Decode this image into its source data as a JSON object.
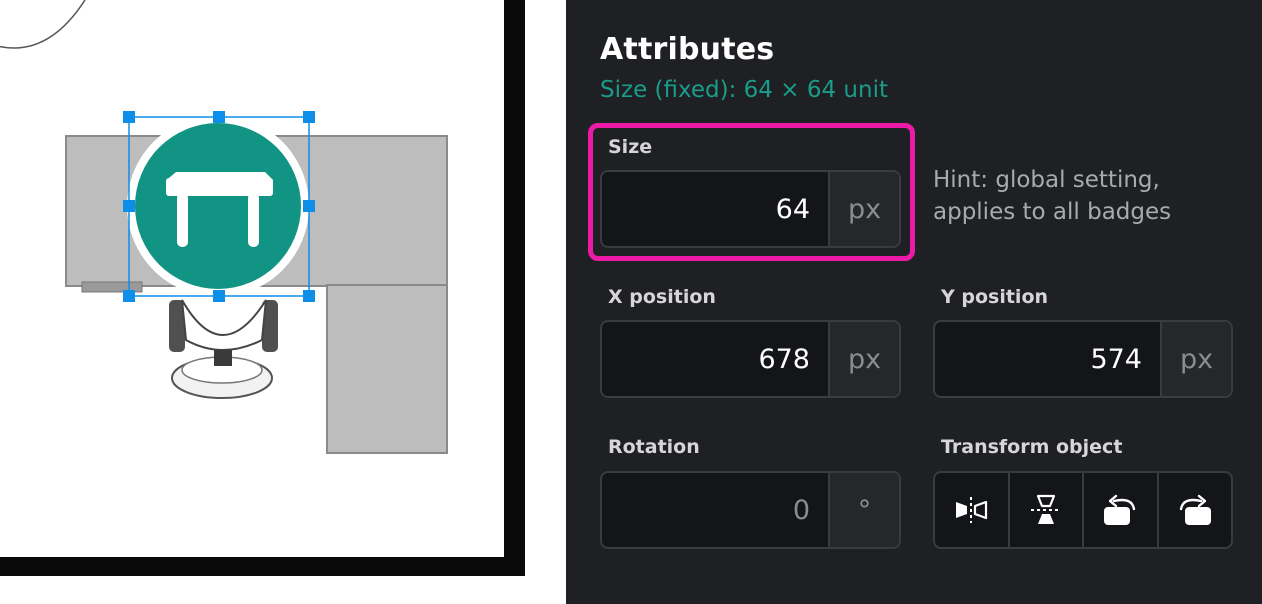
{
  "panel": {
    "title": "Attributes",
    "subtitle": "Size (fixed): 64 × 64 unit",
    "size": {
      "label": "Size",
      "value": "64",
      "unit": "px"
    },
    "hint": "Hint: global setting, applies to all badges",
    "x_position": {
      "label": "X position",
      "value": "678",
      "unit": "px"
    },
    "y_position": {
      "label": "Y position",
      "value": "574",
      "unit": "px"
    },
    "rotation": {
      "label": "Rotation",
      "value": "0",
      "unit": "°"
    },
    "transform": {
      "label": "Transform object",
      "buttons": [
        "flip-horizontal-icon",
        "flip-vertical-icon",
        "rotate-left-icon",
        "rotate-right-icon"
      ]
    }
  },
  "colors": {
    "panel_bg": "#1f2023",
    "accent_teal": "#1a9c8a",
    "highlight_magenta": "#ec1ba6",
    "badge_teal": "#129484",
    "selection_blue": "#0d8ee9"
  }
}
